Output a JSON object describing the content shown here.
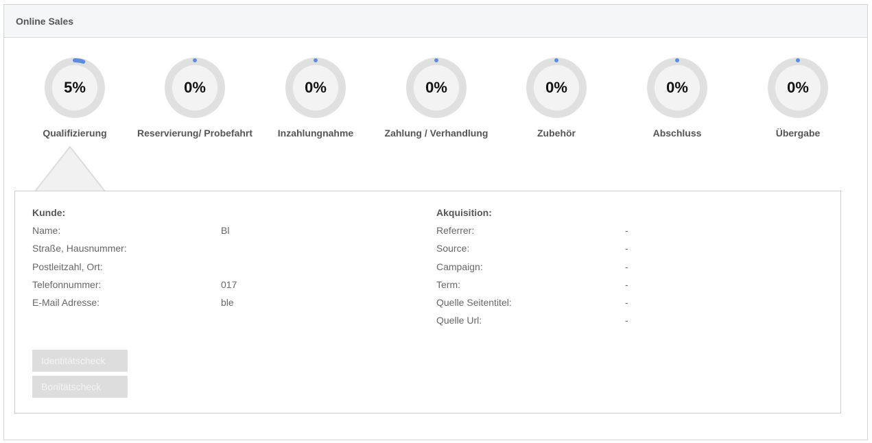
{
  "panel": {
    "title": "Online Sales"
  },
  "steps": [
    {
      "label": "Qualifizierung",
      "percent_text": "5%",
      "progress": 0.05
    },
    {
      "label": "Reservierung/ Probefahrt",
      "percent_text": "0%",
      "progress": 0
    },
    {
      "label": "Inzahlungnahme",
      "percent_text": "0%",
      "progress": 0
    },
    {
      "label": "Zahlung / Verhandlung",
      "percent_text": "0%",
      "progress": 0
    },
    {
      "label": "Zubehör",
      "percent_text": "0%",
      "progress": 0
    },
    {
      "label": "Abschluss",
      "percent_text": "0%",
      "progress": 0
    },
    {
      "label": "Übergabe",
      "percent_text": "0%",
      "progress": 0
    }
  ],
  "colors": {
    "ring_track": "#e0e0e0",
    "ring_progress": "#5b8ee0",
    "ring_inner": "#f3f3f3"
  },
  "customer": {
    "title": "Kunde:",
    "rows": [
      {
        "label": "Name:",
        "value": "Bl"
      },
      {
        "label": "Straße, Hausnummer:",
        "value": ""
      },
      {
        "label": "Postleitzahl, Ort:",
        "value": ""
      },
      {
        "label": "Telefonnummer:",
        "value": "017"
      },
      {
        "label": "E-Mail Adresse:",
        "value": "ble"
      }
    ]
  },
  "acquisition": {
    "title": "Akquisition:",
    "rows": [
      {
        "label": "Referrer:",
        "value": "-"
      },
      {
        "label": "Source:",
        "value": "-"
      },
      {
        "label": "Campaign:",
        "value": "-"
      },
      {
        "label": "Term:",
        "value": "-"
      },
      {
        "label": "Quelle Seitentitel:",
        "value": "-"
      },
      {
        "label": "Quelle Url:",
        "value": "-"
      }
    ]
  },
  "buttons": {
    "identity": "Identitätscheck",
    "credit": "Bonitätscheck"
  }
}
